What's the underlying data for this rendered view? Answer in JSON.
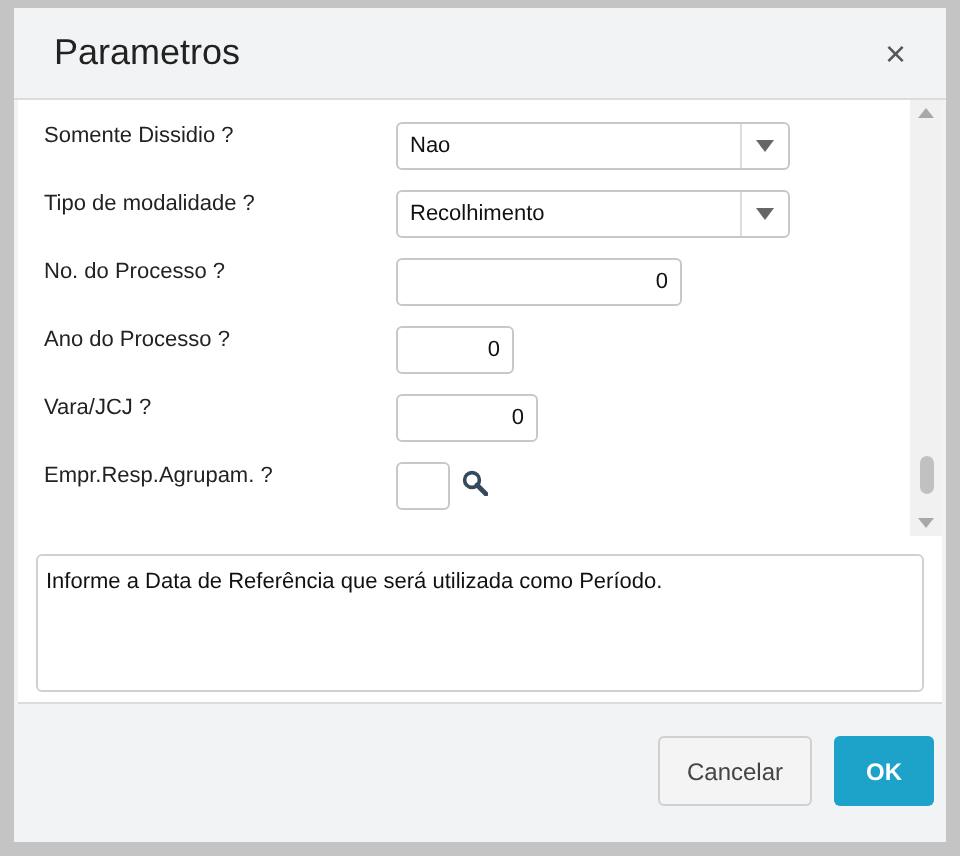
{
  "dialog": {
    "title": "Parametros",
    "close": "×"
  },
  "fields": [
    {
      "kind": "select",
      "label": "Somente Dissidio ?",
      "value": "Nao"
    },
    {
      "kind": "select",
      "label": "Tipo de modalidade ?",
      "value": "Recolhimento"
    },
    {
      "kind": "text",
      "label": "No. do Processo ?",
      "value": "0"
    },
    {
      "kind": "text",
      "label": "Ano do Processo ?",
      "value": "0"
    },
    {
      "kind": "text",
      "label": "Vara/JCJ ?",
      "value": "0"
    },
    {
      "kind": "lookup",
      "label": "Empr.Resp.Agrupam. ?"
    }
  ],
  "help_text": "Informe a Data de Referência que será utilizada como Período.",
  "buttons": [
    {
      "label": "Cancelar",
      "kind": "secondary"
    },
    {
      "label": "OK",
      "kind": "primary"
    }
  ]
}
